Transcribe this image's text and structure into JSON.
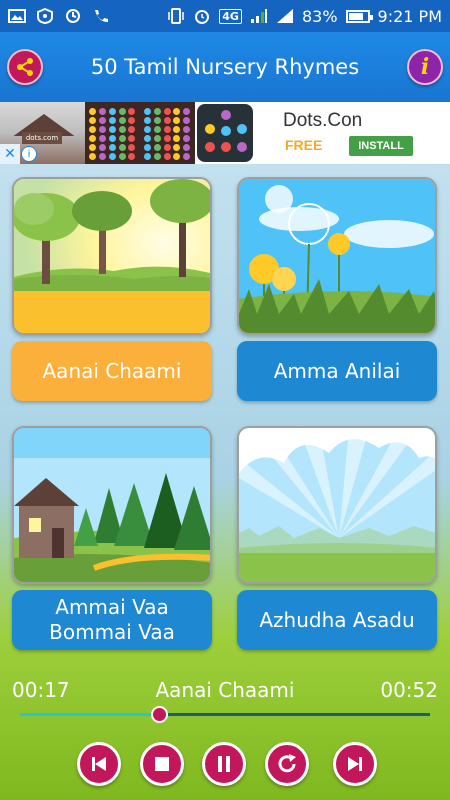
{
  "status_bar": {
    "network": "4G",
    "battery": "83%",
    "battery_level": 0.83,
    "time": "9:21 PM"
  },
  "app_bar": {
    "title": "50 Tamil Nursery Rhymes",
    "share_icon": "share-icon",
    "info_icon": "info-icon",
    "info_glyph": "i"
  },
  "ad": {
    "title": "Dots.Con",
    "price": "FREE",
    "install_label": "INSTALL",
    "close_glyph": "✕",
    "info_glyph": "i",
    "house_sign": "dots.com"
  },
  "rhymes": [
    {
      "label": "Aanai Chaami",
      "color": "#fbb03b",
      "scene": "trees-sunny"
    },
    {
      "label": "Amma Anilai",
      "color": "#1e88d2",
      "scene": "dandelions"
    },
    {
      "label": "Ammai Vaa Bommai Vaa",
      "color": "#1e88d2",
      "scene": "cabin-forest"
    },
    {
      "label": "Azhudha Asadu",
      "color": "#1e88d2",
      "scene": "sunburst-clouds"
    }
  ],
  "player": {
    "elapsed": "00:17",
    "now_playing": "Aanai Chaami",
    "duration": "00:52",
    "progress": 0.34,
    "controls": [
      "previous-icon",
      "stop-icon",
      "pause-icon",
      "repeat-icon",
      "next-icon"
    ]
  },
  "colors": {
    "status_bar": "#1565c0",
    "app_bar": "#1976d2",
    "control_button": "#c2185b",
    "accent_orange": "#fbb03b",
    "accent_blue": "#1e88d2"
  }
}
